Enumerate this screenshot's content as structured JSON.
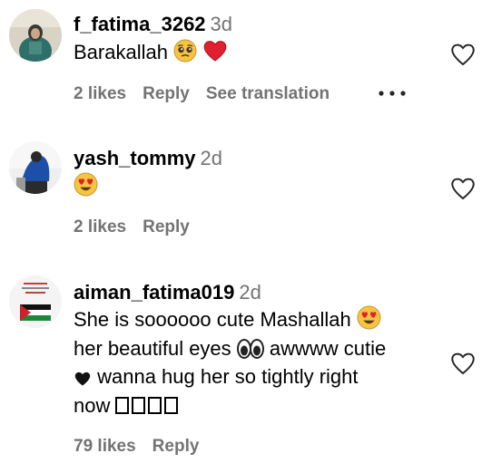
{
  "comments": [
    {
      "username": "f_fatima_3262",
      "time": "3d",
      "text_parts": [
        "Barakallah"
      ],
      "likes": "2 likes",
      "reply": "Reply",
      "translate": "See translation",
      "icons": [
        "pleading-face-emoji",
        "red-heart-emoji",
        "more-options-icon",
        "like-heart-icon"
      ]
    },
    {
      "username": "yash_tommy",
      "time": "2d",
      "text_parts": [],
      "likes": "2 likes",
      "reply": "Reply",
      "icons": [
        "heart-eyes-emoji",
        "like-heart-icon"
      ]
    },
    {
      "username": "aiman_fatima019",
      "time": "2d",
      "text_parts": [
        "She is soooooo cute Mashallah ",
        "her beautiful eyes ",
        " awwww cutie",
        " wanna hug her so tightly right",
        "now "
      ],
      "likes": "79 likes",
      "reply": "Reply",
      "icons": [
        "heart-eyes-emoji",
        "eyes-emoji",
        "black-heart-emoji",
        "unsupported-glyph-boxes",
        "like-heart-icon"
      ]
    }
  ],
  "colors": {
    "secondary_text": "#737373",
    "heart_red": "#e0202e",
    "emoji_yellow": "#f5c542"
  }
}
